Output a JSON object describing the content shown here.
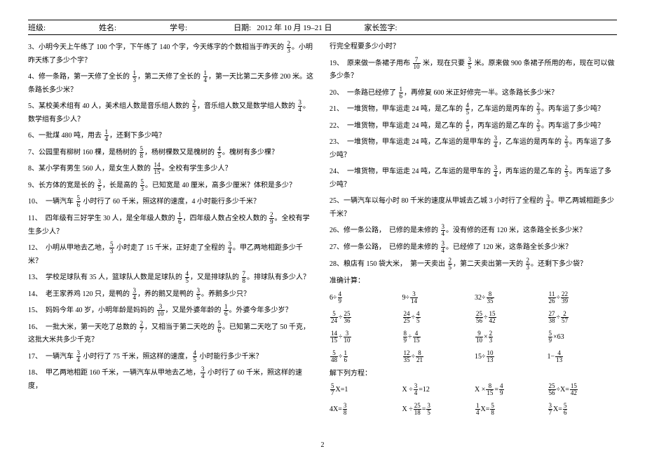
{
  "header": {
    "class_label": "班级:",
    "name_label": "姓名:",
    "id_label": "学号:",
    "date_label": "日期:",
    "date_value": "2012 年 10 月 19–21 日",
    "sign_label": "家长签字:"
  },
  "left_col": {
    "p3": "3、小明今天上午练了 100 个字，下午练了 140 个字，今天练字的个数相当于昨天的 ⟨2/3⟩。小明昨天练了多少个字？",
    "p4": "4、修一条路，第一天修了全长的 ⟨1/3⟩，第二天修了全长的 ⟨1/4⟩，第一天比第二天多修 200 米。这条路长多少米？",
    "p5": "5、某校美术组有 40 人，美术组人数是音乐组人数的 ⟨2/3⟩，音乐组人数又是数学组人数的 ⟨3/4⟩。数学组有多少人？",
    "p6": "6、一批煤 480 吨，用去 ⟨1/4⟩，还剩下多少吨？",
    "p7": "7、公园里有柳树 160 棵，是杨树的 ⟨5/8⟩，杨树棵数又是槐树的 ⟨4/5⟩。槐树有多少棵？",
    "p8": "8、某小学有男生 560 人，是女生人数的 ⟨14/15⟩。全校有学生多少人？",
    "p9": "9、长方体的宽是长的 ⟨3/5⟩，长是高的 ⟨5/3⟩。已知宽是 40 厘米，高多少厘米？体积是多少？",
    "p10": "10、　一辆汽车 ⟨5/6⟩ 小时行了 60 千米，照这样的速度，4 小时能行多少千米？",
    "p11": "11、　四年级有三好学生 30 人，是全年级人数的 ⟨1/6⟩，四年级人数占全校人数的 ⟨2/9⟩。全校有学生多少人？",
    "p12": "12、　小明从甲地去乙地，⟨5/3⟩ 小时走了 15 千米，正好走了全程的 ⟨3/4⟩。甲乙两地相距多少千米？",
    "p13": "13、　学校足球队有 35 人，篮球队人数是足球队的 ⟨4/5⟩，又是排球队的 ⟨7/8⟩。排球队有多少人？",
    "p14": "14、　老王家养鸡 120 只，是鸭的 ⟨3/4⟩，养的鹅又是鸭的 ⟨3/5⟩。养鹅多少只？",
    "p15": "15、　妈妈今年 40 岁，小明年龄是妈妈的 ⟨3/10⟩，又是外婆年龄的 ⟨1/6⟩。外婆今年多少岁？",
    "p16": "16、　一批大米，第一天吃了总数的 ⟨2/7⟩，又相当于第二天吃的 ⟨5/6⟩。已知第二天吃了 50 千克，这批大米共多少千克？",
    "p17": "17、　一辆汽车 ⟨3/4⟩ 小时行了 75 千米，照这样的速度，⟨4/5⟩ 小时能行多少千米？",
    "p18": "18、　甲乙两地相距 160 千米，一辆汽车从甲地去乙地，⟨3/4⟩ 小时行了 60 千米，照这样的速度，"
  },
  "right_col": {
    "p18b": "行完全程要多少小时？",
    "p19": "19、　原来做一条裙子用布 ⟨7/10⟩ 米，现在只要 ⟨3/5⟩ 米。原来做 900 条裙子所用的布，现在可以做多少条？",
    "p20": "20、　一条路已经修了 ⟨1/6⟩，再修复 600 米正好修完一半。这条路长多少米？",
    "p21": "21、　一堆货物，甲车运走 24 吨，是乙车的 ⟨4/5⟩，乙车运的是丙车的 ⟨2/3⟩。丙车运了多少吨？",
    "p22": "22、　一堆货物，甲车运走 24 吨，是乙车的 ⟨4/5⟩，丙车运的是乙车的 ⟨2/3⟩。丙车运了多少吨？",
    "p23": "23、　一堆货物，甲车运走 24 吨，乙车运的是甲车的 ⟨3/4⟩，乙车运的是丙车的 ⟨2/3⟩。丙车运了多少吨？",
    "p24": "24、　一堆货物，甲车运走 24 吨，乙车运的是甲车的 ⟨3/4⟩，丙车运的是乙车的 ⟨2/3⟩。丙车运了多少吨？",
    "p25": "25、一辆汽车以每小时 80 千米的速度从甲城去乙城 3 小时行了全程的 ⟨3/4⟩。甲乙两城相距多少千米？",
    "p26": "26、修一条公路，　已修的是未修的 ⟨3/4⟩。没有修的还有 120 米，这条路全长多少米？",
    "p27": "27、修一条公路，　已修的是未修的 ⟨3/4⟩。已经修了 120 米，这条路全长多少米？",
    "p28": "28、粮店有 150 袋大米，　第一天卖出 ⟨2/5⟩，第二天卖出第一天的 ⟨2/3⟩。还剩下多少袋？",
    "calc_title": "准确计算：",
    "c1": "6÷⟨4/9⟩",
    "c2": "9÷⟨3/14⟩",
    "c3": "32÷⟨8/35⟩",
    "c4": "⟨11/26⟩÷⟨22/39⟩",
    "c5": "⟨5/24⟩÷⟨25/36⟩",
    "c6": "⟨24/25⟩÷⟨4/5⟩",
    "c7": "⟨25/56⟩÷⟨15/42⟩",
    "c8": "⟨27/38⟩÷⟨2/57⟩",
    "c9": "⟨14/15⟩÷⟨3/10⟩",
    "c10": "⟨8/9⟩÷⟨4/15⟩",
    "c11": "⟨9/10⟩×⟨2/3⟩",
    "c12": "⟨5/9⟩×63",
    "c13": "⟨5/48⟩÷⟨1/6⟩",
    "c14": "⟨12/35⟩÷⟨8/21⟩",
    "c15": "15÷⟨10/13⟩",
    "c16": "1−⟨4/13⟩",
    "eq_title": "解下列方程：",
    "e1": "⟨5/7⟩X=1",
    "e2": "X ÷⟨3/4⟩=12",
    "e3": "X ×⟨8/15⟩=⟨4/9⟩",
    "e4": "⟨25/56⟩÷X=⟨15/42⟩",
    "e5": "4X=⟨3/8⟩",
    "e6": "X ÷⟨25/18⟩=⟨3/5⟩",
    "e7": "⟨1/4⟩X=⟨5/8⟩",
    "e8": "⟨3/7⟩X=⟨5/6⟩"
  },
  "footer": {
    "page": "2"
  },
  "chart_data": {
    "type": "table",
    "title": "准确计算 / 解下列方程",
    "columns": [
      "col1",
      "col2",
      "col3",
      "col4"
    ],
    "rows_calc": [
      [
        "6÷4/9",
        "9÷3/14",
        "32÷8/35",
        "11/26÷22/39"
      ],
      [
        "5/24÷25/36",
        "24/25÷4/5",
        "25/56÷15/42",
        "27/38÷2/57"
      ],
      [
        "14/15÷3/10",
        "8/9÷4/15",
        "9/10×2/3",
        "5/9×63"
      ],
      [
        "5/48÷1/6",
        "12/35÷8/21",
        "15÷10/13",
        "1−4/13"
      ]
    ],
    "rows_eq": [
      [
        "5/7 X = 1",
        "X ÷ 3/4 = 12",
        "X × 8/15 = 4/9",
        "25/56 ÷ X = 15/42"
      ],
      [
        "4X = 3/8",
        "X ÷ 25/18 = 3/5",
        "1/4 X = 5/8",
        "3/7 X = 5/6"
      ]
    ]
  }
}
